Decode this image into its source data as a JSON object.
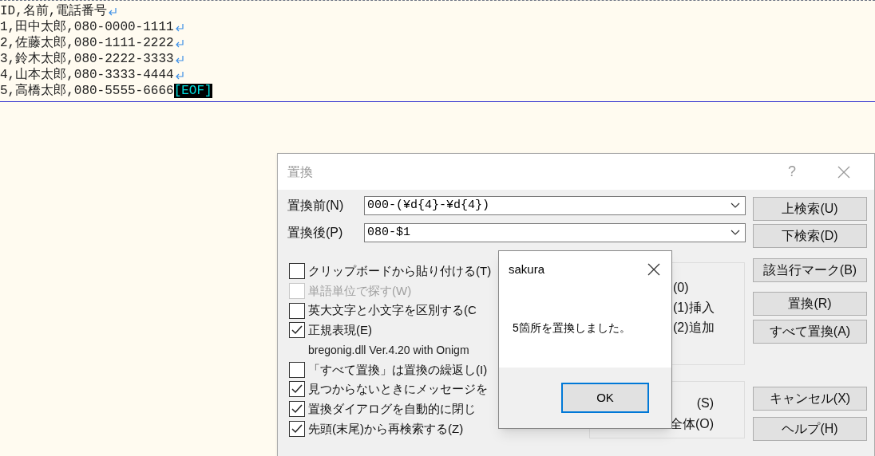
{
  "editor": {
    "lines": [
      {
        "text": "ID,名前,電話番号",
        "kind": "line"
      },
      {
        "text": "1,田中太郎,080-0000-1111",
        "kind": "line"
      },
      {
        "text": "2,佐藤太郎,080-1111-2222",
        "kind": "line"
      },
      {
        "text": "3,鈴木太郎,080-2222-3333",
        "kind": "line"
      },
      {
        "text": "4,山本太郎,080-3333-4444",
        "kind": "line"
      },
      {
        "text": "5,高橋太郎,080-5555-6666",
        "kind": "last",
        "eof_label": "[EOF]"
      }
    ]
  },
  "replace_dialog": {
    "title": "置換",
    "help": "?",
    "fields": [
      {
        "label": "置換前(N)",
        "value": "000-(¥d{4}-¥d{4})"
      },
      {
        "label": "置換後(P)",
        "value": "080-$1"
      }
    ],
    "options": [
      {
        "kind": "checkbox",
        "label": "クリップボードから貼り付ける(T)",
        "checked": false,
        "disabled": false
      },
      {
        "kind": "checkbox",
        "label": "単語単位で探す(W)",
        "checked": false,
        "disabled": true
      },
      {
        "kind": "checkbox",
        "label": "英大文字と小文字を区別する(C",
        "checked": false,
        "disabled": false
      },
      {
        "kind": "checkbox",
        "label": "正規表現(E)",
        "checked": true,
        "disabled": false
      },
      {
        "kind": "note",
        "label": "bregonig.dll Ver.4.20 with Onigm"
      },
      {
        "kind": "checkbox",
        "label": "「すべて置換」は置換の繰返し(I)",
        "checked": false,
        "disabled": false
      },
      {
        "kind": "checkbox",
        "label": "見つからないときにメッセージを",
        "checked": true,
        "disabled": false
      },
      {
        "kind": "checkbox",
        "label": "置換ダイアログを自動的に閉じ",
        "checked": true,
        "disabled": false
      },
      {
        "kind": "checkbox",
        "label": "先頭(末尾)から再検索する(Z)",
        "checked": true,
        "disabled": false
      }
    ],
    "group_1": [
      "(0)",
      "(1)挿入",
      "(2)追加"
    ],
    "group_2": [
      "(S)",
      "全体(O)"
    ],
    "buttons": [
      "上検索(U)",
      "下検索(D)",
      "該当行マーク(B)",
      "置換(R)",
      "すべて置換(A)",
      "キャンセル(X)",
      "ヘルプ(H)"
    ]
  },
  "message_box": {
    "title": "sakura",
    "message": "5箇所を置換しました。",
    "button": "OK"
  }
}
